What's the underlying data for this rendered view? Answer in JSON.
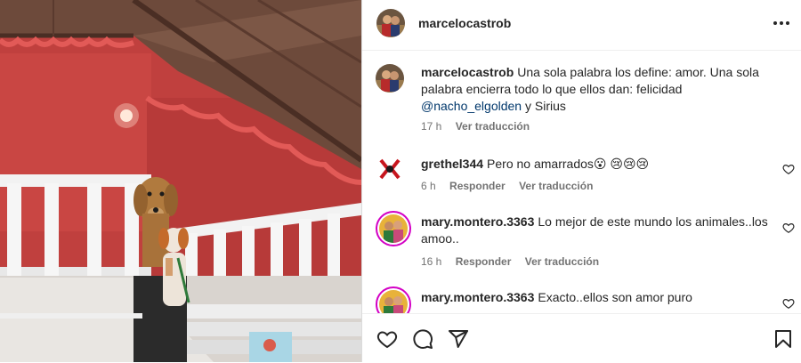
{
  "post": {
    "author": "marcelocastrob",
    "caption": {
      "username": "marcelocastrob",
      "text_before": "Una sola palabra los define: amor. Una sola palabra encierra todo lo que ellos dan: felicidad ",
      "mention": "@nacho_elgolden",
      "text_after": " y Sirius",
      "time": "17 h",
      "translate": "Ver traducción"
    }
  },
  "comments": [
    {
      "username": "grethel344",
      "text": "Pero no amarrados😮 😢😢😢",
      "time": "6 h",
      "reply": "Responder",
      "translate": "Ver traducción"
    },
    {
      "username": "mary.montero.3363",
      "text": "Lo mejor de este mundo los animales..los amoo..",
      "time": "16 h",
      "reply": "Responder",
      "translate": "Ver traducción"
    },
    {
      "username": "mary.montero.3363",
      "text": "Exacto..ellos son amor puro"
    }
  ],
  "icons": {
    "more": "more-options-icon",
    "like": "heart-icon",
    "comment": "comment-icon",
    "share": "share-icon",
    "save": "bookmark-icon"
  },
  "colors": {
    "mention": "#00376b",
    "meta": "#737373",
    "story_ring": "#d300c5"
  }
}
